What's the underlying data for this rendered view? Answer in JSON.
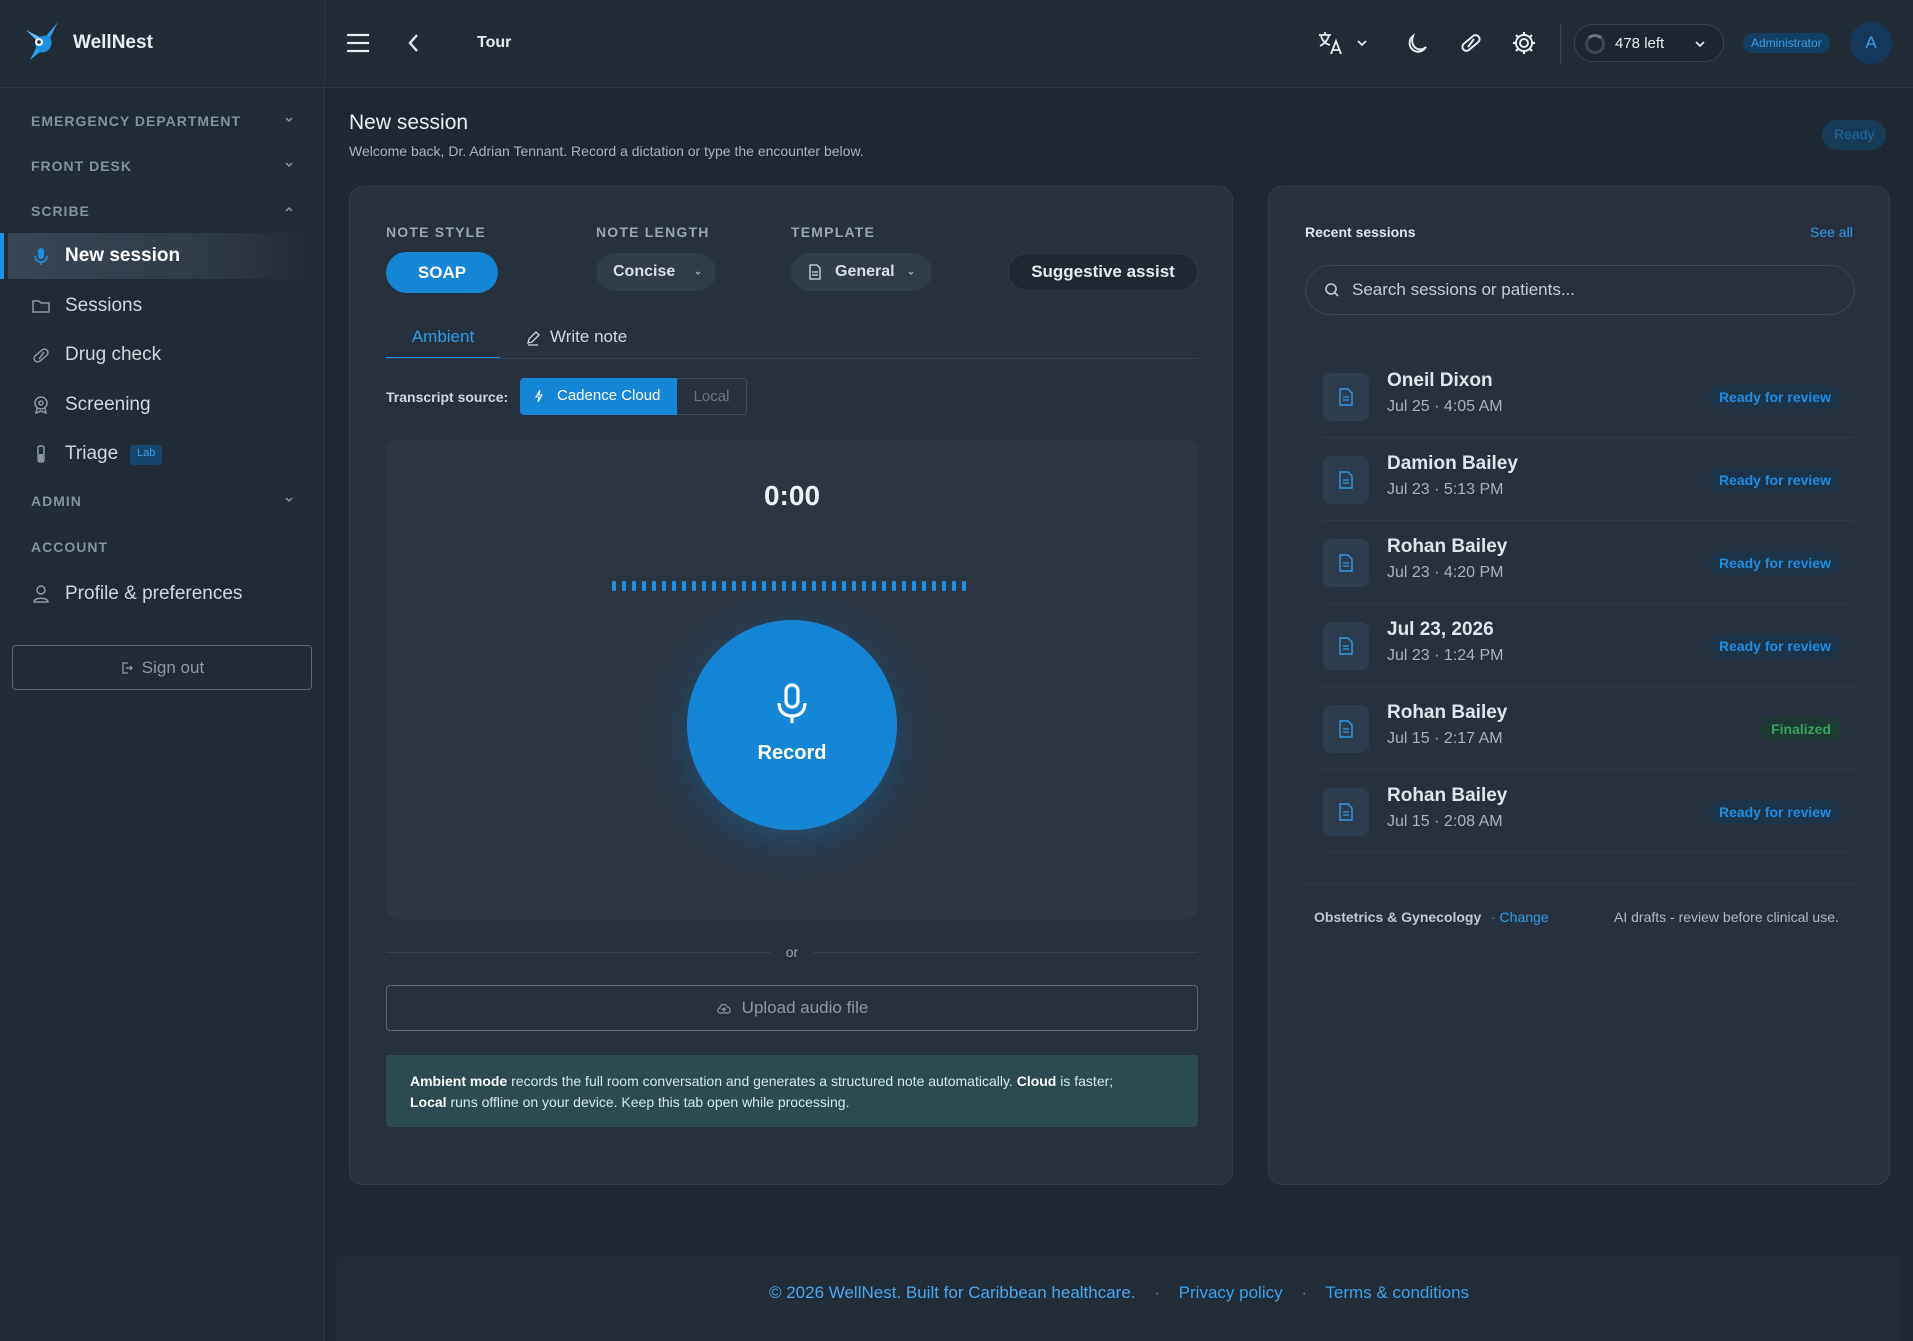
{
  "brand": {
    "name": "WellNest"
  },
  "topbar": {
    "tour_label": "Tour",
    "credits": "478 left",
    "role": "Administrator",
    "avatar_initial": "A"
  },
  "sidebar": {
    "sections": {
      "emergency": "EMERGENCY DEPARTMENT",
      "front_desk": "FRONT DESK",
      "scribe": "SCRIBE",
      "admin": "ADMIN",
      "account": "ACCOUNT"
    },
    "items": [
      {
        "label": "New session",
        "icon": "microphone-icon"
      },
      {
        "label": "Sessions",
        "icon": "folder-icon"
      },
      {
        "label": "Drug check",
        "icon": "pill-icon"
      },
      {
        "label": "Screening",
        "icon": "screening-icon"
      },
      {
        "label": "Triage",
        "icon": "test-tube-icon",
        "badge": "Lab"
      }
    ],
    "profile_label": "Profile & preferences",
    "sign_out": "Sign out"
  },
  "page": {
    "title": "New session",
    "subtitle": "Welcome back, Dr. Adrian Tennant. Record a dictation or type the encounter below.",
    "status": "Ready"
  },
  "options": {
    "note_style_label": "NOTE STYLE",
    "note_style_value": "SOAP",
    "note_length_label": "NOTE LENGTH",
    "note_length_value": "Concise",
    "template_label": "TEMPLATE",
    "template_value": "General",
    "assist_label": "Suggestive assist"
  },
  "tabs": {
    "ambient": "Ambient",
    "write": "Write note"
  },
  "transcript": {
    "label": "Transcript source:",
    "cloud": "Cadence Cloud",
    "local": "Local"
  },
  "recorder": {
    "timer": "0:00",
    "record_label": "Record"
  },
  "or_label": "or",
  "upload_label": "Upload audio file",
  "info": {
    "ambient_bold": "Ambient mode",
    "text1": " records the full room conversation and generates a structured note automatically. ",
    "cloud_bold": "Cloud",
    "text2": " is faster;",
    "local_bold": "Local",
    "text3": " runs offline on your device. Keep this tab open while processing."
  },
  "recent": {
    "title": "Recent sessions",
    "see_all": "See all",
    "search_placeholder": "Search sessions or patients...",
    "sessions": [
      {
        "name": "Oneil Dixon",
        "date": "Jul 25 · 4:05 AM",
        "status": "Ready for review"
      },
      {
        "name": "Damion Bailey",
        "date": "Jul 23 · 5:13 PM",
        "status": "Ready for review"
      },
      {
        "name": "Rohan Bailey",
        "date": "Jul 23 · 4:20 PM",
        "status": "Ready for review"
      },
      {
        "name": "Jul 23, 2026",
        "date": "Jul 23 · 1:24 PM",
        "status": "Ready for review"
      },
      {
        "name": "Rohan Bailey",
        "date": "Jul 15 · 2:17 AM",
        "status": "Finalized"
      },
      {
        "name": "Rohan Bailey",
        "date": "Jul 15 · 2:08 AM",
        "status": "Ready for review"
      }
    ],
    "specialty": "Obstetrics & Gynecology",
    "change": "· Change",
    "ai_note": "AI drafts - review before clinical use."
  },
  "footer": {
    "copyright": "© 2026 WellNest. Built for Caribbean healthcare.",
    "privacy": "Privacy policy",
    "terms": "Terms & conditions",
    "separator": "·"
  },
  "colors": {
    "accent": "#1585d6",
    "link": "#2f9bea",
    "background": "#1e2833",
    "card": "#27313d",
    "finalized": "#34a35c"
  }
}
